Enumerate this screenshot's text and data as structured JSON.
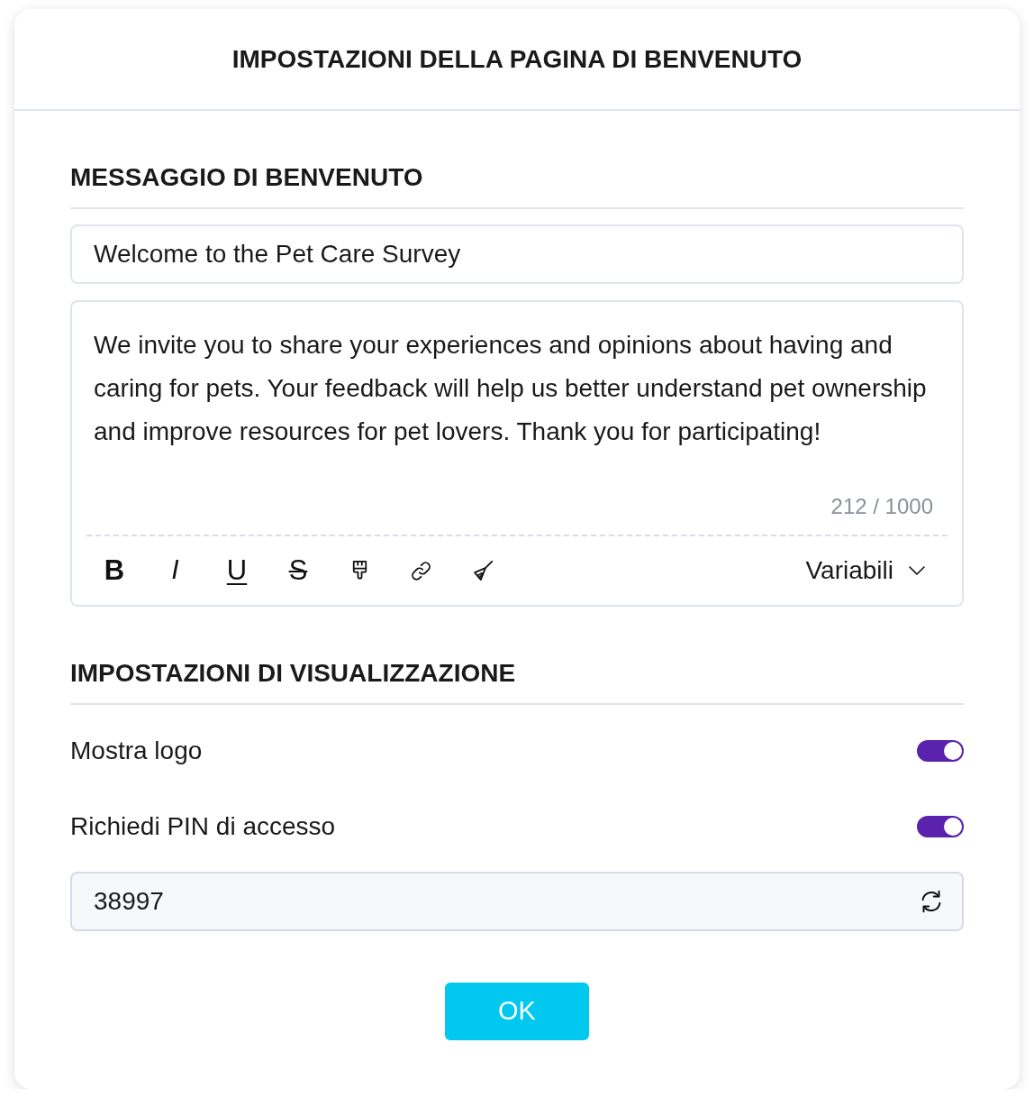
{
  "dialog": {
    "title": "IMPOSTAZIONI DELLA PAGINA DI BENVENUTO"
  },
  "welcome_message": {
    "heading": "MESSAGGIO DI BENVENUTO",
    "title_field": {
      "value": "Welcome to the Pet Care Survey"
    },
    "body": {
      "value": "We invite you to share your experiences and opinions about having and caring for pets. Your feedback will help us better understand pet ownership and improve resources for pet lovers. Thank you for participating!",
      "counter": "212 / 1000"
    },
    "toolbar": {
      "buttons": [
        {
          "kind": "bold",
          "label": "B"
        },
        {
          "kind": "italic",
          "label": "I"
        },
        {
          "kind": "underline",
          "label": "U"
        },
        {
          "kind": "strikethrough",
          "label": "S"
        },
        {
          "kind": "brush"
        },
        {
          "kind": "link"
        },
        {
          "kind": "eraser"
        }
      ],
      "variables_button": "Variabili"
    }
  },
  "display_settings": {
    "heading": "IMPOSTAZIONI DI VISUALIZZAZIONE",
    "toggles": [
      {
        "label": "Mostra logo",
        "on": true
      },
      {
        "label": "Richiedi PIN di accesso",
        "on": true
      }
    ],
    "pin_field": {
      "value": "38997"
    }
  },
  "buttons": [
    {
      "label": "OK"
    }
  ]
}
